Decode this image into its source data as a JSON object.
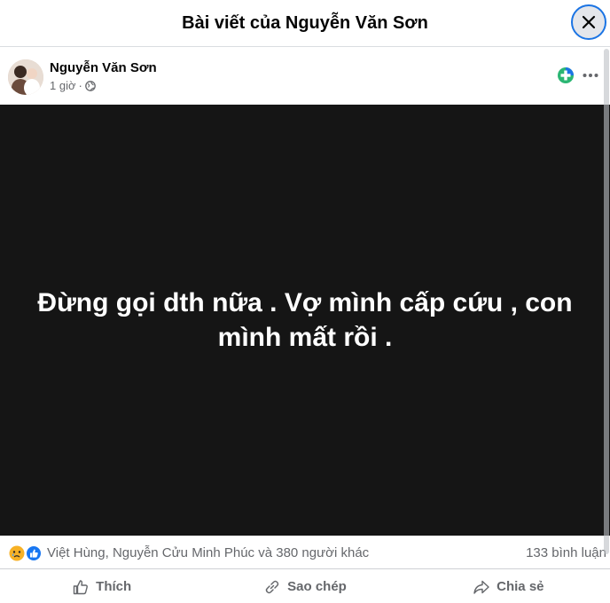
{
  "dialog": {
    "title": "Bài viết của Nguyễn Văn Sơn"
  },
  "post": {
    "author": "Nguyễn Văn Sơn",
    "time": "1 giờ",
    "separator": "·",
    "audience_icon": "globe-icon",
    "text": "Đừng gọi dth nữa . Vợ mình cấp cứu , con mình mất rồi ."
  },
  "reactions": {
    "icons": [
      "sad-reaction-icon",
      "like-reaction-icon"
    ],
    "names": "Việt Hùng, Nguyễn Cửu Minh Phúc và 380 người khác",
    "comments": "133 bình luận"
  },
  "actions": {
    "like": "Thích",
    "copy": "Sao chép",
    "share": "Chia sẻ"
  },
  "colors": {
    "accent": "#1b74e4",
    "post_background": "#151515",
    "secondary_text": "#65676b"
  }
}
